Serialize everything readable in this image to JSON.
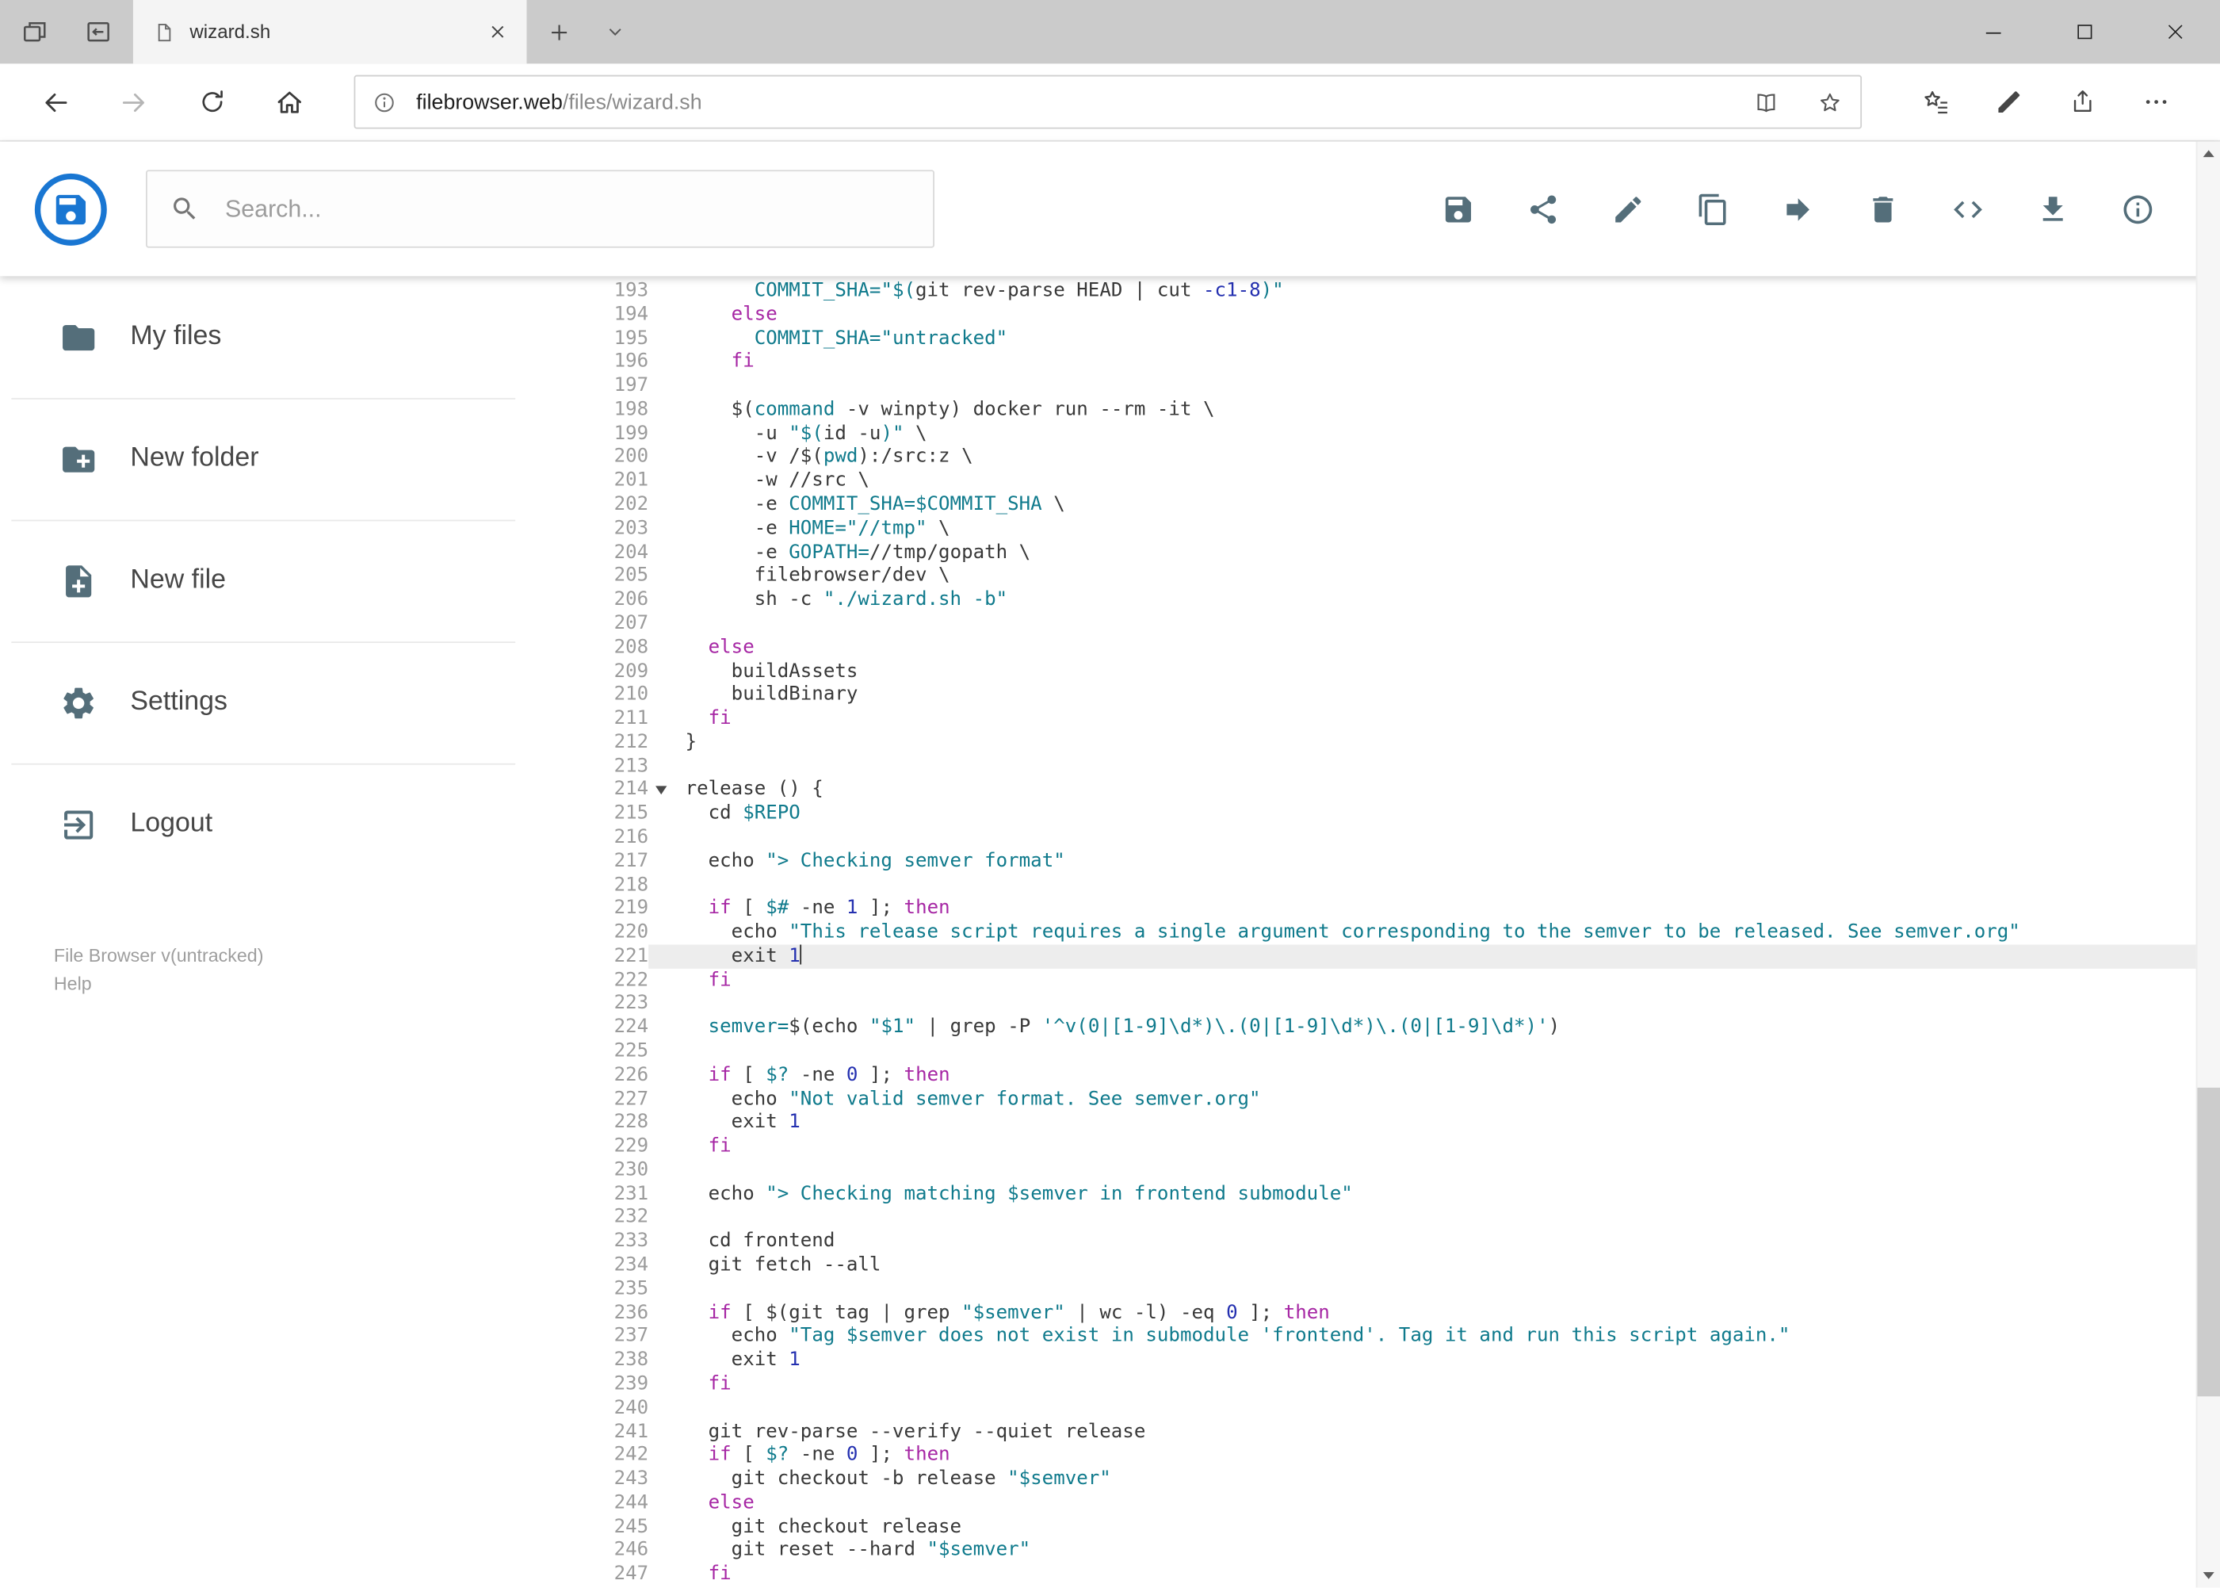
{
  "browser": {
    "tab_title": "wizard.sh",
    "url_host": "filebrowser.web",
    "url_path": "/files/wizard.sh",
    "tab_left_icons": [
      "tab-preview-icon",
      "set-tabs-aside-icon"
    ],
    "tab_icons": [
      "page-icon",
      "close-tab-icon",
      "new-tab-icon",
      "tabs-dropdown-icon"
    ],
    "nav_icons": [
      "back-icon",
      "forward-icon",
      "refresh-icon",
      "home-icon"
    ],
    "address_icons": [
      "site-info-icon",
      "reading-view-icon",
      "favorite-star-icon"
    ],
    "toolbar_icons": [
      "hub-icon",
      "web-note-pen-icon",
      "share-page-icon",
      "more-options-icon"
    ],
    "window_control_icons": [
      "minimize-icon",
      "maximize-icon",
      "close-window-icon"
    ]
  },
  "app": {
    "logo_icon": "filebrowser-logo",
    "accent_color": "#1976d2",
    "icon_color": "#546e7a",
    "search_placeholder": "Search...",
    "actions": [
      {
        "id": "save",
        "icon": "save-icon"
      },
      {
        "id": "share",
        "icon": "share-icon"
      },
      {
        "id": "edit",
        "icon": "edit-icon"
      },
      {
        "id": "copy",
        "icon": "copy-icon"
      },
      {
        "id": "move",
        "icon": "move-icon"
      },
      {
        "id": "delete",
        "icon": "delete-icon"
      },
      {
        "id": "code",
        "icon": "code-icon"
      },
      {
        "id": "download",
        "icon": "download-icon"
      },
      {
        "id": "info",
        "icon": "info-circle-icon"
      }
    ]
  },
  "sidebar": {
    "items": [
      {
        "id": "my-files",
        "label": "My files",
        "icon": "folder-icon"
      },
      {
        "id": "new-folder",
        "label": "New folder",
        "icon": "new-folder-icon"
      },
      {
        "id": "new-file",
        "label": "New file",
        "icon": "new-file-icon"
      },
      {
        "id": "settings",
        "label": "Settings",
        "icon": "gear-icon"
      },
      {
        "id": "logout",
        "label": "Logout",
        "icon": "logout-icon"
      }
    ],
    "footer_version": "File Browser v(untracked)",
    "footer_help": "Help"
  },
  "editor": {
    "active_line": 221,
    "fold_line": 214,
    "syntax_colors": {
      "keyword": "#a626a4",
      "string": "#0f7a8c",
      "variable": "#0f7a8c",
      "number": "#2430b0",
      "plain": "#383838"
    },
    "lines": [
      {
        "n": 193,
        "t": [
          [
            "p",
            "      "
          ],
          [
            "v",
            "COMMIT_SHA="
          ],
          [
            "s",
            "\"$("
          ],
          [
            "p",
            "git rev-parse HEAD | cut "
          ],
          [
            "n",
            "-c1-8"
          ],
          [
            "s",
            ")\""
          ]
        ]
      },
      {
        "n": 194,
        "t": [
          [
            "p",
            "    "
          ],
          [
            "k",
            "else"
          ]
        ]
      },
      {
        "n": 195,
        "t": [
          [
            "p",
            "      "
          ],
          [
            "v",
            "COMMIT_SHA="
          ],
          [
            "s",
            "\"untracked\""
          ]
        ]
      },
      {
        "n": 196,
        "t": [
          [
            "p",
            "    "
          ],
          [
            "k",
            "fi"
          ]
        ]
      },
      {
        "n": 197,
        "t": []
      },
      {
        "n": 198,
        "t": [
          [
            "p",
            "    $("
          ],
          [
            "v",
            "command"
          ],
          [
            "p",
            " -v winpty) docker run --rm -it \\"
          ]
        ]
      },
      {
        "n": 199,
        "t": [
          [
            "p",
            "      -u "
          ],
          [
            "s",
            "\"$("
          ],
          [
            "p",
            "id -u"
          ],
          [
            "s",
            ")\""
          ],
          [
            "p",
            " \\"
          ]
        ]
      },
      {
        "n": 200,
        "t": [
          [
            "p",
            "      -v /$("
          ],
          [
            "v",
            "pwd"
          ],
          [
            "p",
            "):/src:z \\"
          ]
        ]
      },
      {
        "n": 201,
        "t": [
          [
            "p",
            "      -w //src \\"
          ]
        ]
      },
      {
        "n": 202,
        "t": [
          [
            "p",
            "      -e "
          ],
          [
            "v",
            "COMMIT_SHA=$COMMIT_SHA"
          ],
          [
            "p",
            " \\"
          ]
        ]
      },
      {
        "n": 203,
        "t": [
          [
            "p",
            "      -e "
          ],
          [
            "v",
            "HOME="
          ],
          [
            "s",
            "\"//tmp\""
          ],
          [
            "p",
            " \\"
          ]
        ]
      },
      {
        "n": 204,
        "t": [
          [
            "p",
            "      -e "
          ],
          [
            "v",
            "GOPATH="
          ],
          [
            "p",
            "//tmp/gopath \\"
          ]
        ]
      },
      {
        "n": 205,
        "t": [
          [
            "p",
            "      filebrowser/dev \\"
          ]
        ]
      },
      {
        "n": 206,
        "t": [
          [
            "p",
            "      sh -c "
          ],
          [
            "s",
            "\"./wizard.sh -b\""
          ]
        ]
      },
      {
        "n": 207,
        "t": []
      },
      {
        "n": 208,
        "t": [
          [
            "p",
            "  "
          ],
          [
            "k",
            "else"
          ]
        ]
      },
      {
        "n": 209,
        "t": [
          [
            "p",
            "    buildAssets"
          ]
        ]
      },
      {
        "n": 210,
        "t": [
          [
            "p",
            "    buildBinary"
          ]
        ]
      },
      {
        "n": 211,
        "t": [
          [
            "p",
            "  "
          ],
          [
            "k",
            "fi"
          ]
        ]
      },
      {
        "n": 212,
        "t": [
          [
            "p",
            "}"
          ]
        ]
      },
      {
        "n": 213,
        "t": []
      },
      {
        "n": 214,
        "t": [
          [
            "p",
            "release () {"
          ]
        ],
        "fold": true
      },
      {
        "n": 215,
        "t": [
          [
            "p",
            "  cd "
          ],
          [
            "v",
            "$REPO"
          ]
        ]
      },
      {
        "n": 216,
        "t": []
      },
      {
        "n": 217,
        "t": [
          [
            "p",
            "  echo "
          ],
          [
            "s",
            "\"> Checking semver format\""
          ]
        ]
      },
      {
        "n": 218,
        "t": []
      },
      {
        "n": 219,
        "t": [
          [
            "p",
            "  "
          ],
          [
            "k",
            "if"
          ],
          [
            "p",
            " [ "
          ],
          [
            "v",
            "$#"
          ],
          [
            "p",
            " -ne "
          ],
          [
            "n",
            "1"
          ],
          [
            "p",
            " ]; "
          ],
          [
            "k",
            "then"
          ]
        ]
      },
      {
        "n": 220,
        "t": [
          [
            "p",
            "    echo "
          ],
          [
            "s",
            "\"This release script requires a single argument corresponding to the semver to be released. See semver.org\""
          ]
        ]
      },
      {
        "n": 221,
        "t": [
          [
            "p",
            "    exit "
          ],
          [
            "n",
            "1"
          ]
        ],
        "caret": true,
        "active": true
      },
      {
        "n": 222,
        "t": [
          [
            "p",
            "  "
          ],
          [
            "k",
            "fi"
          ]
        ]
      },
      {
        "n": 223,
        "t": []
      },
      {
        "n": 224,
        "t": [
          [
            "p",
            "  "
          ],
          [
            "v",
            "semver="
          ],
          [
            "p",
            "$(echo "
          ],
          [
            "s",
            "\"$1\""
          ],
          [
            "p",
            " | grep -P "
          ],
          [
            "s",
            "'^v(0|[1-9]\\d*)\\.(0|[1-9]\\d*)\\.(0|[1-9]\\d*)'"
          ],
          [
            "p",
            ")"
          ]
        ]
      },
      {
        "n": 225,
        "t": []
      },
      {
        "n": 226,
        "t": [
          [
            "p",
            "  "
          ],
          [
            "k",
            "if"
          ],
          [
            "p",
            " [ "
          ],
          [
            "v",
            "$?"
          ],
          [
            "p",
            " -ne "
          ],
          [
            "n",
            "0"
          ],
          [
            "p",
            " ]; "
          ],
          [
            "k",
            "then"
          ]
        ]
      },
      {
        "n": 227,
        "t": [
          [
            "p",
            "    echo "
          ],
          [
            "s",
            "\"Not valid semver format. See semver.org\""
          ]
        ]
      },
      {
        "n": 228,
        "t": [
          [
            "p",
            "    exit "
          ],
          [
            "n",
            "1"
          ]
        ]
      },
      {
        "n": 229,
        "t": [
          [
            "p",
            "  "
          ],
          [
            "k",
            "fi"
          ]
        ]
      },
      {
        "n": 230,
        "t": []
      },
      {
        "n": 231,
        "t": [
          [
            "p",
            "  echo "
          ],
          [
            "s",
            "\"> Checking matching "
          ],
          [
            "v",
            "$semver"
          ],
          [
            "s",
            " in frontend submodule\""
          ]
        ]
      },
      {
        "n": 232,
        "t": []
      },
      {
        "n": 233,
        "t": [
          [
            "p",
            "  cd frontend"
          ]
        ]
      },
      {
        "n": 234,
        "t": [
          [
            "p",
            "  git fetch --all"
          ]
        ]
      },
      {
        "n": 235,
        "t": []
      },
      {
        "n": 236,
        "t": [
          [
            "p",
            "  "
          ],
          [
            "k",
            "if"
          ],
          [
            "p",
            " [ $(git tag | grep "
          ],
          [
            "s",
            "\"$semver\""
          ],
          [
            "p",
            " | wc -l) -eq "
          ],
          [
            "n",
            "0"
          ],
          [
            "p",
            " ]; "
          ],
          [
            "k",
            "then"
          ]
        ]
      },
      {
        "n": 237,
        "t": [
          [
            "p",
            "    echo "
          ],
          [
            "s",
            "\"Tag "
          ],
          [
            "v",
            "$semver"
          ],
          [
            "s",
            " does not exist in submodule 'frontend'. Tag it and run this script again.\""
          ]
        ]
      },
      {
        "n": 238,
        "t": [
          [
            "p",
            "    exit "
          ],
          [
            "n",
            "1"
          ]
        ]
      },
      {
        "n": 239,
        "t": [
          [
            "p",
            "  "
          ],
          [
            "k",
            "fi"
          ]
        ]
      },
      {
        "n": 240,
        "t": []
      },
      {
        "n": 241,
        "t": [
          [
            "p",
            "  git rev-parse --verify --quiet release"
          ]
        ]
      },
      {
        "n": 242,
        "t": [
          [
            "p",
            "  "
          ],
          [
            "k",
            "if"
          ],
          [
            "p",
            " [ "
          ],
          [
            "v",
            "$?"
          ],
          [
            "p",
            " -ne "
          ],
          [
            "n",
            "0"
          ],
          [
            "p",
            " ]; "
          ],
          [
            "k",
            "then"
          ]
        ]
      },
      {
        "n": 243,
        "t": [
          [
            "p",
            "    git checkout -b release "
          ],
          [
            "s",
            "\"$semver\""
          ]
        ]
      },
      {
        "n": 244,
        "t": [
          [
            "p",
            "  "
          ],
          [
            "k",
            "else"
          ]
        ]
      },
      {
        "n": 245,
        "t": [
          [
            "p",
            "    git checkout release"
          ]
        ]
      },
      {
        "n": 246,
        "t": [
          [
            "p",
            "    git reset --hard "
          ],
          [
            "s",
            "\"$semver\""
          ]
        ]
      },
      {
        "n": 247,
        "t": [
          [
            "p",
            "  "
          ],
          [
            "k",
            "fi"
          ]
        ]
      }
    ]
  }
}
